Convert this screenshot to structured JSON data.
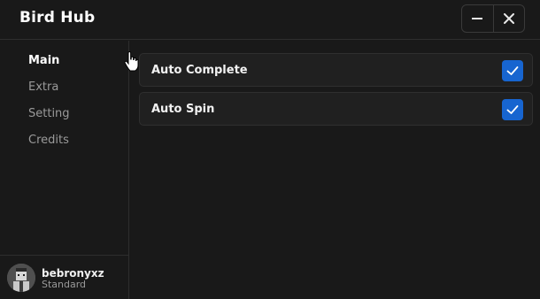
{
  "window": {
    "title": "Bird Hub",
    "minimize_icon": "minus-icon",
    "close_icon": "close-icon"
  },
  "sidebar": {
    "items": [
      {
        "label": "Main",
        "active": true
      },
      {
        "label": "Extra",
        "active": false
      },
      {
        "label": "Setting",
        "active": false
      },
      {
        "label": "Credits",
        "active": false
      }
    ]
  },
  "user": {
    "name": "bebronyxz",
    "rank": "Standard"
  },
  "main": {
    "options": [
      {
        "label": "Auto Complete",
        "checked": true
      },
      {
        "label": "Auto Spin",
        "checked": true
      }
    ]
  },
  "colors": {
    "background": "#191919",
    "panel": "#202020",
    "accent": "#1765d0",
    "text_muted": "#9a9a9a"
  }
}
